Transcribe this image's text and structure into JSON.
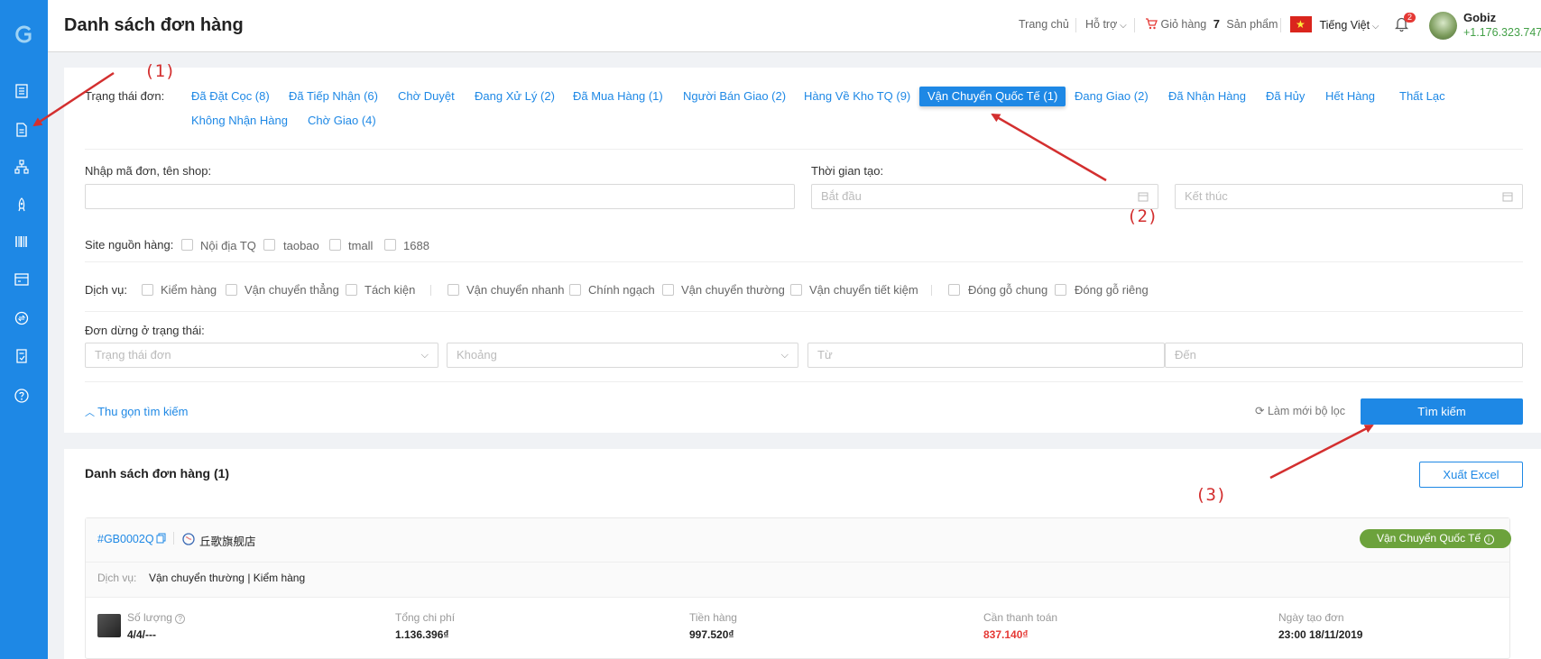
{
  "header": {
    "title": "Danh sách đơn hàng",
    "home": "Trang chủ",
    "support": "Hỗ trợ",
    "cart_label": "Giỏ hàng",
    "cart_count": "7",
    "cart_unit": "Sản phẩm",
    "language": "Tiếng Việt",
    "notif_count": "2",
    "username": "Gobiz",
    "balance": "+1.176.323.747₫"
  },
  "filters": {
    "status_label": "Trạng thái đơn:",
    "statuses": [
      "Đã Đặt Cọc (8)",
      "Đã Tiếp Nhận (6)",
      "Chờ Duyệt",
      "Đang Xử Lý (2)",
      "Đã Mua Hàng (1)",
      "Người Bán Giao (2)",
      "Hàng Về Kho TQ (9)",
      "Vận Chuyển Quốc Tế (1)",
      "Đang Giao (2)",
      "Đã Nhận Hàng",
      "Đã Hủy",
      "Hết Hàng",
      "Thất Lạc",
      "Không Nhận Hàng",
      "Chờ Giao (4)"
    ],
    "code_label": "Nhập mã đơn, tên shop:",
    "time_label": "Thời gian tạo:",
    "start_placeholder": "Bắt đầu",
    "end_placeholder": "Kết thúc",
    "site_label": "Site nguồn hàng:",
    "sites": [
      "Nội địa TQ",
      "taobao",
      "tmall",
      "1688"
    ],
    "service_label": "Dịch vụ:",
    "services": [
      "Kiểm hàng",
      "Vận chuyển thẳng",
      "Tách kiện",
      "Vận chuyển nhanh",
      "Chính ngạch",
      "Vận chuyển thường",
      "Vận chuyển tiết kiệm",
      "Đóng gỗ chung",
      "Đóng gỗ riêng"
    ],
    "stuck_label": "Đơn dừng ở trạng thái:",
    "stuck_status_placeholder": "Trạng thái đơn",
    "range_placeholder": "Khoảng",
    "from_placeholder": "Từ",
    "to_placeholder": "Đến",
    "collapse": "Thu gọn tìm kiếm",
    "reset": "Làm mới bộ lọc",
    "search": "Tìm kiếm"
  },
  "list": {
    "title": "Danh sách đơn hàng (1)",
    "export": "Xuất Excel",
    "order": {
      "code": "#GB0002Q",
      "shop": "丘歌旗舰店",
      "status": "Vận Chuyển Quốc Tế",
      "service_label": "Dịch vụ:",
      "services": "Vận chuyển thường",
      "services2": "Kiểm hàng",
      "qty_label": "Số lượng",
      "qty": "4/4/---",
      "total_label": "Tổng chi phí",
      "total": "1.136.396₫",
      "goods_label": "Tiền hàng",
      "goods": "997.520₫",
      "due_label": "Cần thanh toán",
      "due": "837.140₫",
      "date_label": "Ngày tạo đơn",
      "date": "23:00 18/11/2019"
    }
  },
  "annotations": [
    "(1)",
    "(2)",
    "(3)"
  ],
  "colors": {
    "primary": "#1e88e5",
    "annotation": "#d32f2f",
    "status_green": "#6ca23c",
    "due_red": "#e53935"
  }
}
